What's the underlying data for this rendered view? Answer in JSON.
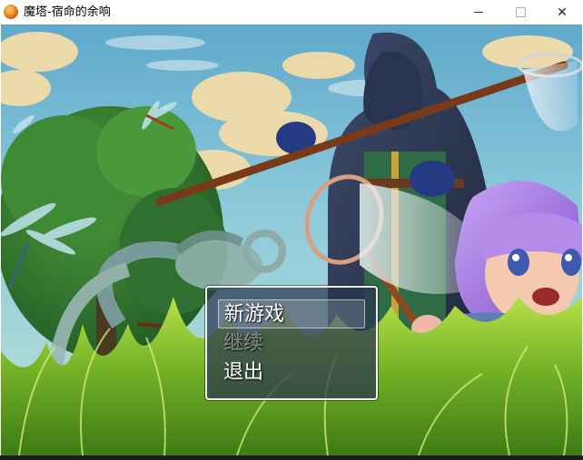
{
  "window": {
    "title": "魔塔-宿命的余响",
    "icon": "orb-app-icon"
  },
  "controls": {
    "minimize": "minimize-icon",
    "maximize": "maximize-icon",
    "close_glyph": "✕"
  },
  "menu": {
    "items": [
      {
        "label": "新游戏",
        "selected": true,
        "enabled": true
      },
      {
        "label": "继续",
        "selected": false,
        "enabled": false
      },
      {
        "label": "退出",
        "selected": false,
        "enabled": true
      }
    ]
  },
  "colors": {
    "sky_top": "#6fb7d6",
    "menu_bg": "#28344e",
    "grass": "#7fbf2a"
  }
}
